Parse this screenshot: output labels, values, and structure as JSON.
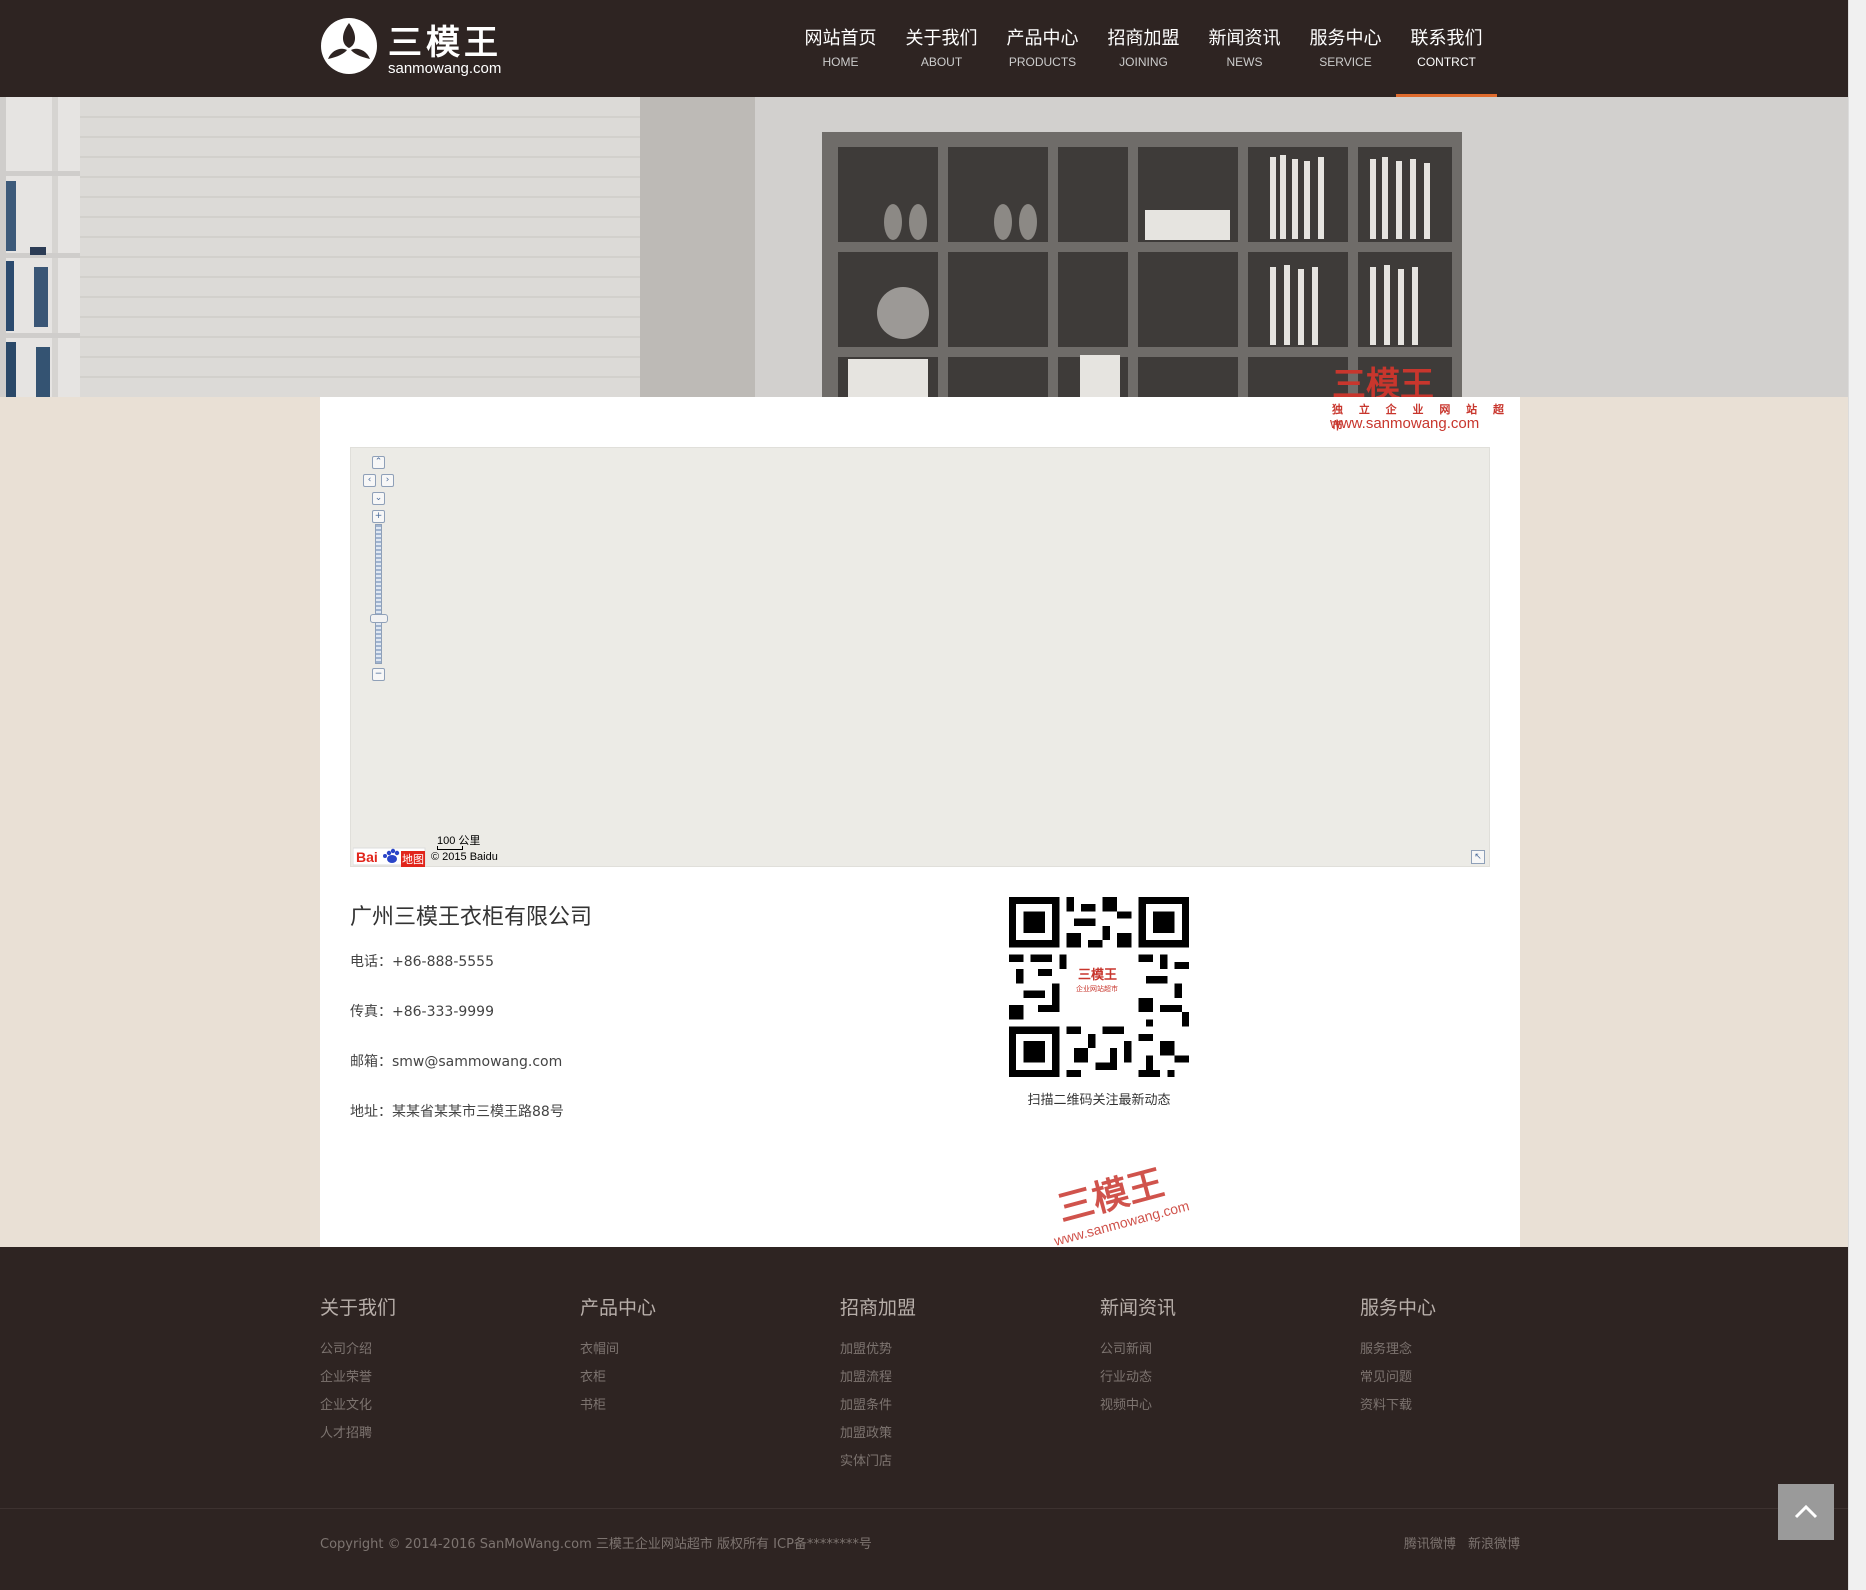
{
  "header": {
    "logo_cn": "三模王",
    "logo_en": "sanmowang.com",
    "nav": [
      {
        "cn": "网站首页",
        "en": "HOME"
      },
      {
        "cn": "关于我们",
        "en": "ABOUT"
      },
      {
        "cn": "产品中心",
        "en": "PRODUCTS"
      },
      {
        "cn": "招商加盟",
        "en": "JOINING"
      },
      {
        "cn": "新闻资讯",
        "en": "NEWS"
      },
      {
        "cn": "服务中心",
        "en": "SERVICE"
      },
      {
        "cn": "联系我们",
        "en": "CONTRCT"
      }
    ],
    "active_index": 6
  },
  "watermark": {
    "brand": "三模王",
    "tagline": "独 立 企 业 网 站 超 市",
    "url": "www.sanmowang.com",
    "qr_brand": "三模王",
    "qr_tagline": "企业网站超市"
  },
  "map": {
    "scale": "100 公里",
    "copyright": "© 2015 Baidu",
    "logo_text": "Bai",
    "logo_suffix": "地图"
  },
  "contact": {
    "company": "广州三模王衣柜有限公司",
    "phone": "电话：+86-888-5555",
    "fax": "传真：+86-333-9999",
    "email": "邮箱：smw@sammowang.com",
    "address": "地址：某某省某某市三模王路88号",
    "qr_caption": "扫描二维码关注最新动态"
  },
  "footer": {
    "columns": [
      {
        "title": "关于我们",
        "links": [
          "公司介绍",
          "企业荣誉",
          "企业文化",
          "人才招聘"
        ]
      },
      {
        "title": "产品中心",
        "links": [
          "衣帽间",
          "衣柜",
          "书柜"
        ]
      },
      {
        "title": "招商加盟",
        "links": [
          "加盟优势",
          "加盟流程",
          "加盟条件",
          "加盟政策",
          "实体门店"
        ]
      },
      {
        "title": "新闻资讯",
        "links": [
          "公司新闻",
          "行业动态",
          "视频中心"
        ]
      },
      {
        "title": "服务中心",
        "links": [
          "服务理念",
          "常见问题",
          "资料下载"
        ]
      }
    ],
    "copyright": "Copyright © 2014-2016 SanMoWang.com 三模王企业网站超市 版权所有   ICP备********号",
    "social": [
      "腾讯微博",
      "新浪微博"
    ]
  },
  "colors": {
    "header_bg": "#2e2422",
    "accent": "#e06b2d",
    "page_bg": "#e9e0d5",
    "watermark": "#c8362d"
  }
}
